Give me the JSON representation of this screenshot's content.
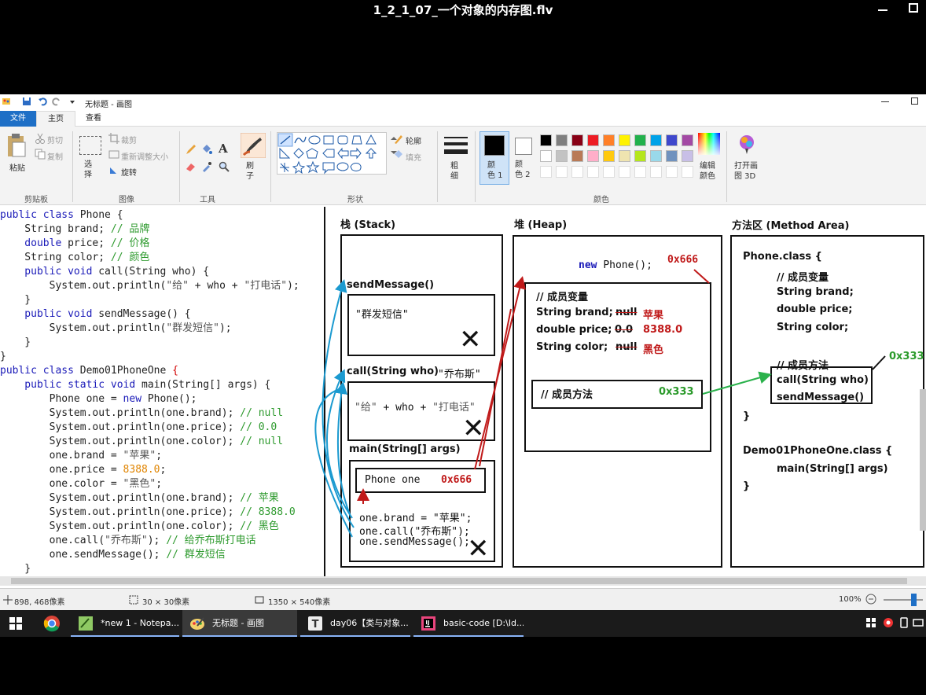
{
  "player": {
    "title": "1_2_1_07_一个对象的内存图.flv"
  },
  "paint": {
    "window_title": "无标题 - 画图",
    "tabs": {
      "file": "文件",
      "home": "主页",
      "view": "查看"
    },
    "clipboard": {
      "paste": "粘贴",
      "cut": "剪切",
      "copy": "复制",
      "group": "剪贴板"
    },
    "image": {
      "select": "选\n择",
      "crop": "裁剪",
      "resize": "重新调整大小",
      "rotate": "旋转",
      "group": "图像"
    },
    "tools": {
      "group": "工具"
    },
    "brushes": {
      "label": "刷\n子"
    },
    "shapes": {
      "outline": "轮廓",
      "fill": "填充",
      "group": "形状"
    },
    "size": {
      "label": "粗\n细"
    },
    "colors": {
      "color1": "颜\n色 1",
      "color2": "颜\n色 2",
      "edit": "编辑\n颜色",
      "group": "颜色",
      "palette": [
        "#000000",
        "#7f7f7f",
        "#880015",
        "#ed1c24",
        "#ff7f27",
        "#fff200",
        "#22b14c",
        "#00a2e8",
        "#3f48cc",
        "#a349a4",
        "#ffffff",
        "#c3c3c3",
        "#b97a57",
        "#ffaec9",
        "#ffc90e",
        "#efe4b0",
        "#b5e61d",
        "#99d9ea",
        "#7092be",
        "#c8bfe7"
      ]
    },
    "paint3d": "打开画\n图 3D",
    "status": {
      "cursor": "898, 468像素",
      "selection": "30 × 30像素",
      "canvas_size": "1350 × 540像素",
      "zoom": "100%"
    }
  },
  "code": {
    "l1": [
      "public class ",
      "Phone {"
    ],
    "l2": [
      "    String brand; ",
      "// 品牌"
    ],
    "l3": [
      "    double ",
      "price; ",
      "// 价格"
    ],
    "l4": [
      "    String color; ",
      "// 颜色"
    ],
    "l5": [
      "    public void ",
      "call(String who) {"
    ],
    "l6": [
      "        System.out.println(",
      "\"给\"",
      " + who + ",
      "\"打电话\"",
      ");"
    ],
    "l7": "    }",
    "l8": [
      "    public void ",
      "sendMessage() {"
    ],
    "l9": [
      "        System.out.println(",
      "\"群发短信\"",
      ");"
    ],
    "l10": "    }",
    "l11": "}",
    "l12": [
      "public class ",
      "Demo01PhoneOne ",
      "{"
    ],
    "l13": [
      "    public static void ",
      "main(String[] args) {"
    ],
    "l14": [
      "        Phone one = ",
      "new ",
      "Phone();"
    ],
    "l15": [
      "        System.out.println(one.brand); ",
      "// null"
    ],
    "l16": [
      "        System.out.println(one.price); ",
      "// 0.0"
    ],
    "l17": [
      "        System.out.println(one.color); ",
      "// null"
    ],
    "l18": [
      "        one.brand = ",
      "\"苹果\"",
      ";"
    ],
    "l19": [
      "        one.price = ",
      "8388.0",
      ";"
    ],
    "l20": [
      "        one.color = ",
      "\"黑色\"",
      ";"
    ],
    "l21": [
      "        System.out.println(one.brand); ",
      "// 苹果"
    ],
    "l22": [
      "        System.out.println(one.price); ",
      "// 8388.0"
    ],
    "l23": [
      "        System.out.println(one.color); ",
      "// 黑色"
    ],
    "l24": [
      "        one.call(",
      "\"乔布斯\"",
      "); ",
      "// 给乔布斯打电话"
    ],
    "l25": [
      "        one.sendMessage(); ",
      "// 群发短信"
    ],
    "l26": "    }"
  },
  "diagram": {
    "stack_head": "栈 (Stack)",
    "heap_head": "堆 (Heap)",
    "method_head": "方法区 (Method Area)",
    "send_frame": "sendMessage()",
    "send_text": "\"群发短信\"",
    "call_frame": "call(String who)",
    "call_arg": "\"乔布斯\"",
    "call_text": [
      "\"给\"",
      " + who + ",
      "\"打电话\""
    ],
    "main_frame": "main(String[] args)",
    "phone_one": "Phone  one",
    "addr_obj": "0x666",
    "main_lines": [
      "one.brand = \"苹果\";",
      "one.call(\"乔布斯\");",
      "one.sendMessage();"
    ],
    "heap_new": [
      "new ",
      "Phone();"
    ],
    "heap_addr": "0x666",
    "member_vars": "// 成员变量",
    "brand_lbl": "String brand;",
    "brand_old": "null",
    "brand_new": "苹果",
    "price_lbl": "double price;",
    "price_old": "0.0",
    "price_new": "8388.0",
    "color_lbl": "String color;",
    "color_old": "null",
    "color_new": "黑色",
    "member_methods": "// 成员方法",
    "methods_addr": "0x333",
    "class_phone": "Phone.class {",
    "mv_comment": "// 成员变量",
    "m_brand": "String brand;",
    "m_price": "double price;",
    "m_color": "String color;",
    "mm_comment": "// 成员方法",
    "mm_addr": "0x333",
    "m_call": "call(String who)",
    "m_send": "sendMessage()",
    "close1": "}",
    "class_demo": "Demo01PhoneOne.class {",
    "m_main": "main(String[] args)",
    "close2": "}"
  },
  "taskbar": {
    "items": [
      "*new 1 - Notepa...",
      "无标题 - 画图",
      "day06【类与对象...",
      "basic-code [D:\\Id..."
    ]
  }
}
